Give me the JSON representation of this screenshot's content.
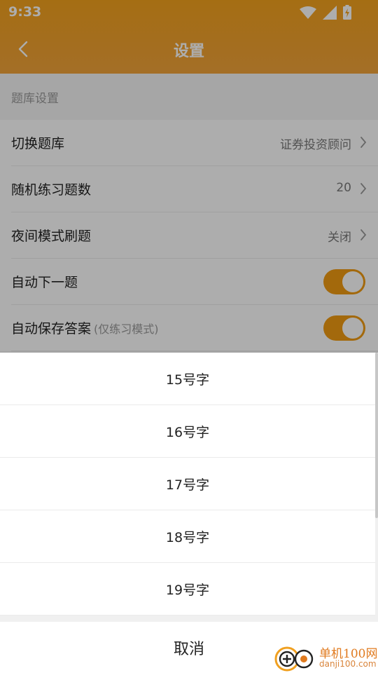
{
  "status_bar": {
    "time": "9:33"
  },
  "header": {
    "title": "设置"
  },
  "section": {
    "title": "题库设置"
  },
  "rows": [
    {
      "label": "切换题库",
      "value": "证券投资顾问"
    },
    {
      "label": "随机练习题数",
      "value": "20"
    },
    {
      "label": "夜间模式刷题",
      "value": "关闭"
    },
    {
      "label": "自动下一题",
      "toggle": true
    },
    {
      "label": "自动保存答案",
      "hint": "(仅练习模式)",
      "toggle": true
    }
  ],
  "sheet": {
    "options": [
      "15号字",
      "16号字",
      "17号字",
      "18号字",
      "19号字"
    ],
    "cancel": "取消"
  },
  "watermark": {
    "name": "单机100网",
    "domain": "danji100.com"
  },
  "colors": {
    "accent": "#f09b13",
    "header": "#f3a21d"
  }
}
